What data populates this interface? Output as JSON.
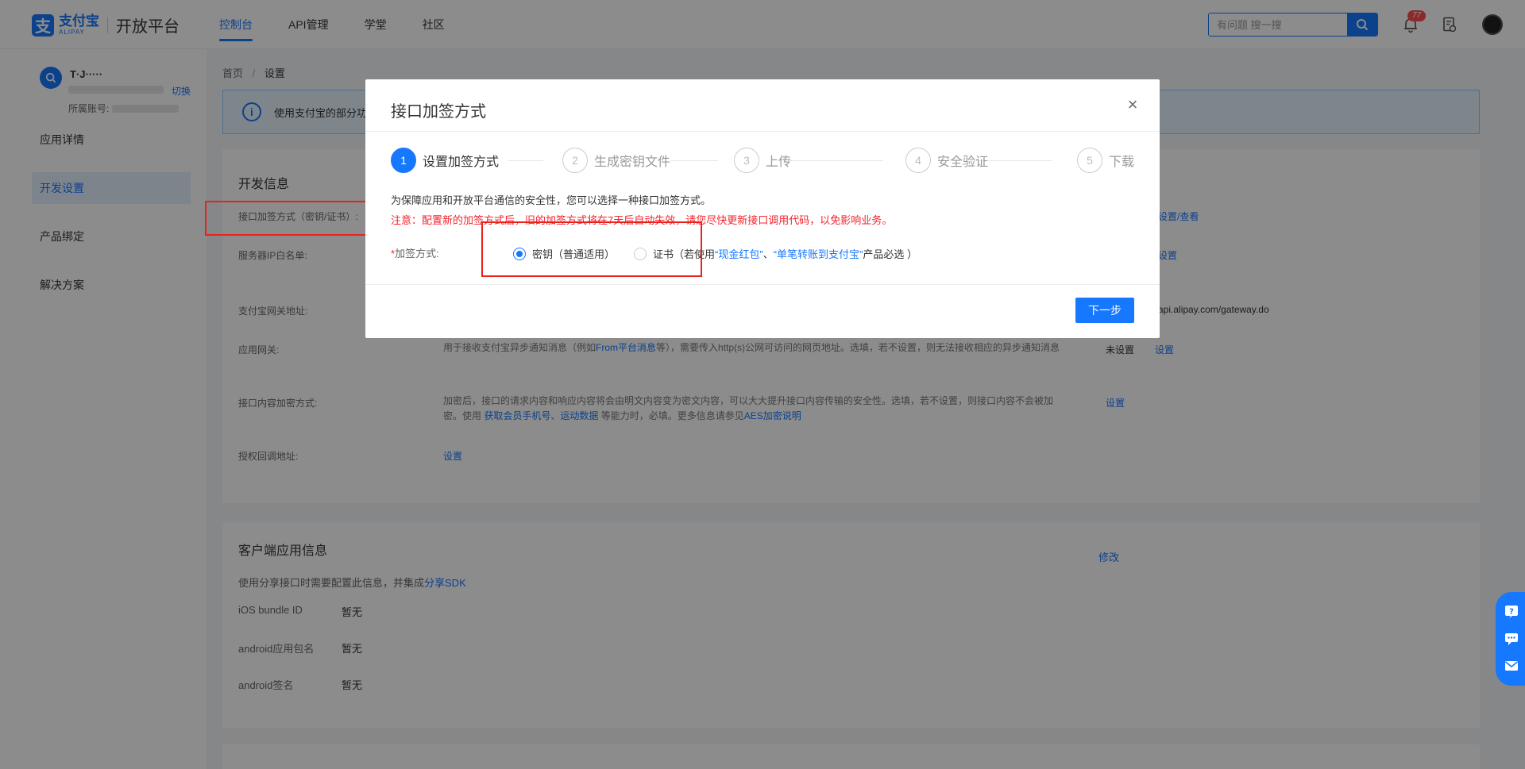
{
  "header": {
    "logo_cn": "支付宝",
    "logo_en": "ALIPAY",
    "platform": "开放平台",
    "nav": [
      {
        "label": "控制台",
        "active": true
      },
      {
        "label": "API管理",
        "active": false
      },
      {
        "label": "学堂",
        "active": false
      },
      {
        "label": "社区",
        "active": false
      }
    ],
    "search_placeholder": "有问题 搜一搜",
    "notification_count": "77"
  },
  "sidebar": {
    "account_name": "T·J·····",
    "switch_label": "切换",
    "belong_label": "所属账号:",
    "items": [
      {
        "label": "应用详情",
        "active": false
      },
      {
        "label": "开发设置",
        "active": true
      },
      {
        "label": "产品绑定",
        "active": false
      },
      {
        "label": "解决方案",
        "active": false
      }
    ]
  },
  "breadcrumb": {
    "home": "首页",
    "sep": "/",
    "current": "设置"
  },
  "notice": {
    "text": "使用支付宝的部分功"
  },
  "dev_card": {
    "title": "开发信息",
    "rows": [
      {
        "label": "接口加签方式（密钥/证书）:",
        "link": "设置/查看"
      },
      {
        "label": "服务器IP白名单:",
        "link": "设置"
      },
      {
        "label": "支付宝网关地址:",
        "value": "api.alipay.com/gateway.do"
      },
      {
        "label": "应用网关:",
        "desc_a": "用于接收支付宝异步通知消息（例如",
        "desc_link": "From平台消息",
        "desc_b": "等），需要传入http(s)公网可访问的网页地址。选填，若不设置，则无法接收相应的异步通知消息",
        "status": "未设置",
        "link": "设置"
      },
      {
        "label": "接口内容加密方式:",
        "desc_a": "加密后，接口的请求内容和响应内容将会由明文内容变为密文内容，可以大大提升接口内容传输的安全性。选填，若不设置，则接口内容不会被加密。使用 ",
        "desc_link1": "获取会员手机号",
        "desc_mid": "、",
        "desc_link2": "运动数据",
        "desc_b": " 等能力时，必填。更多信息请参见",
        "desc_link3": "AES加密说明",
        "link": "设置"
      },
      {
        "label": "授权回调地址:",
        "link": "设置"
      }
    ]
  },
  "client_card": {
    "title": "客户端应用信息",
    "edit_label": "修改",
    "desc": "使用分享接口时需要配置此信息，并集成",
    "desc_link": "分享SDK",
    "items": [
      {
        "label": "iOS bundle ID",
        "value": "暂无"
      },
      {
        "label": "android应用包名",
        "value": "暂无"
      },
      {
        "label": "android签名",
        "value": "暂无"
      }
    ]
  },
  "modal": {
    "title": "接口加签方式",
    "close": "×",
    "steps": [
      {
        "num": "1",
        "label": "设置加签方式",
        "active": true
      },
      {
        "num": "2",
        "label": "生成密钥文件",
        "active": false
      },
      {
        "num": "3",
        "label": "上传",
        "active": false
      },
      {
        "num": "4",
        "label": "安全验证",
        "active": false
      },
      {
        "num": "5",
        "label": "下载",
        "active": false
      }
    ],
    "description": "为保障应用和开放平台通信的安全性，您可以选择一种接口加签方式。",
    "warning": "注意：配置新的加签方式后，旧的加签方式将在7天后自动失效，请您尽快更新接口调用代码，以免影响业务。",
    "form_label_req": "*",
    "form_label": "加签方式:",
    "option_key": "密钥（普通适用）",
    "option_cert_a": "证书（若使用",
    "option_cert_link1": "“现金红包”",
    "option_cert_mid": "、",
    "option_cert_link2": "“单笔转账到支付宝”",
    "option_cert_b": "产品必选 ）",
    "next_label": "下一步"
  },
  "colors": {
    "primary": "#1677ff",
    "warning": "#f5222d",
    "annotation": "#e8231e"
  }
}
